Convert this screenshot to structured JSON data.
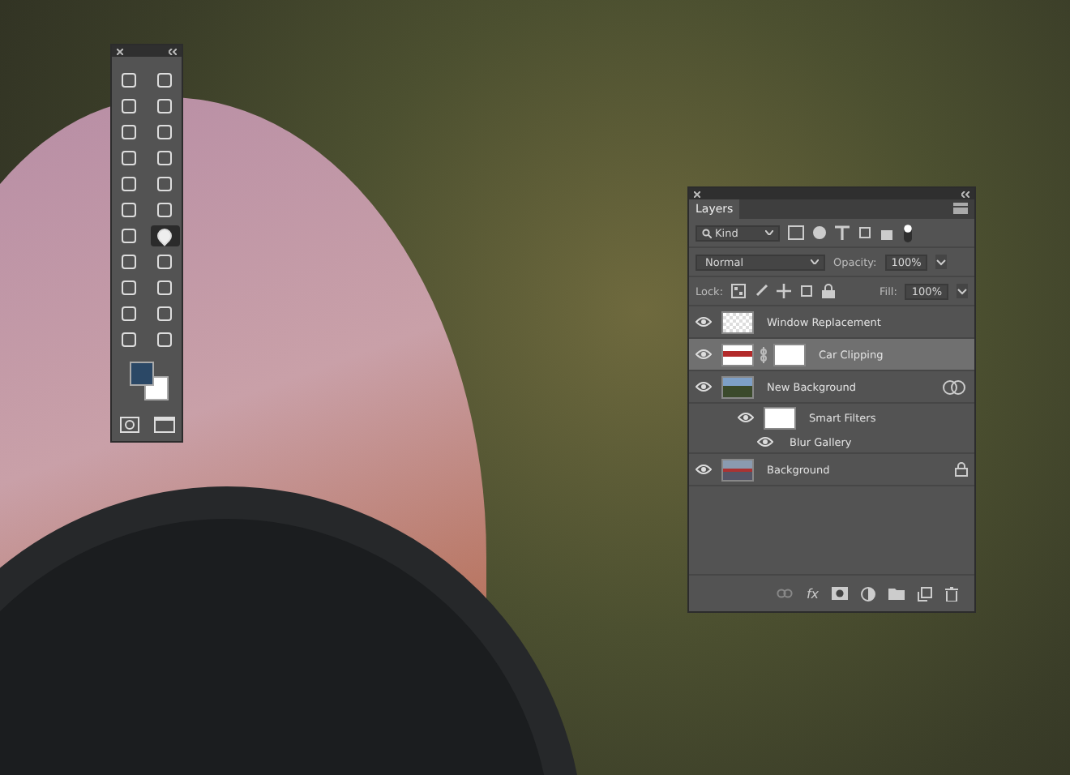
{
  "tools": {
    "items": [
      {
        "selected": false
      },
      {
        "selected": false
      },
      {
        "selected": false
      },
      {
        "selected": false
      },
      {
        "selected": false
      },
      {
        "selected": false
      },
      {
        "selected": false
      },
      {
        "selected": false
      },
      {
        "selected": false
      },
      {
        "selected": false
      },
      {
        "selected": false
      },
      {
        "selected": false
      },
      {
        "selected": false
      },
      {
        "selected": true
      },
      {
        "selected": false
      },
      {
        "selected": false
      },
      {
        "selected": false
      },
      {
        "selected": false
      },
      {
        "selected": false
      },
      {
        "selected": false
      },
      {
        "selected": false
      },
      {
        "selected": false
      }
    ]
  },
  "layers_panel": {
    "tab": "Layers",
    "filter": "Kind",
    "blend_mode": "Normal",
    "opacity_label": "Opacity:",
    "opacity": "100%",
    "lock_label": "Lock:",
    "fill_label": "Fill:",
    "fill": "100%",
    "footer_fx": "fx",
    "layers": [
      {
        "kind": "layer",
        "name": "Window Replacement",
        "visible": true,
        "selected": false,
        "mask": false,
        "locked": false,
        "smart": false
      },
      {
        "kind": "layer",
        "name": "Car Clipping",
        "visible": true,
        "selected": true,
        "mask": true,
        "locked": false,
        "smart": false
      },
      {
        "kind": "layer",
        "name": "New Background",
        "visible": true,
        "selected": false,
        "mask": false,
        "locked": false,
        "smart": true
      },
      {
        "kind": "filters",
        "name": "Smart Filters",
        "visible": true,
        "selected": false,
        "locked": false,
        "smart": false
      },
      {
        "kind": "filter",
        "name": "Blur Gallery",
        "visible": true,
        "selected": false,
        "locked": false,
        "smart": false
      },
      {
        "kind": "layer",
        "name": "Background",
        "visible": true,
        "selected": false,
        "mask": false,
        "locked": true,
        "smart": false
      }
    ]
  }
}
